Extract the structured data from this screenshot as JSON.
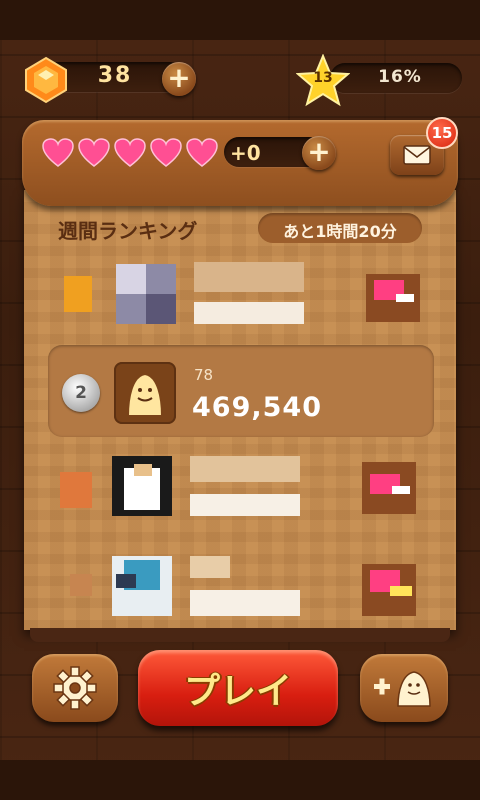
{
  "status": {
    "gem_count": "38",
    "star_level": "13",
    "progress_text": "16%",
    "progress_value": 0.16
  },
  "hearts": {
    "count": 5,
    "bonus_text": "+0"
  },
  "mail": {
    "badge_count": "15"
  },
  "ranking": {
    "title": "週間ランキング",
    "time_remaining": "あと1時間20分",
    "me": {
      "rank": "2",
      "level": "78",
      "score": "469,540"
    }
  },
  "buttons": {
    "play_label": "プレイ"
  },
  "colors": {
    "accent_red": "#d81e10",
    "heart_pink": "#ff4f93",
    "wood": "#c89155"
  }
}
